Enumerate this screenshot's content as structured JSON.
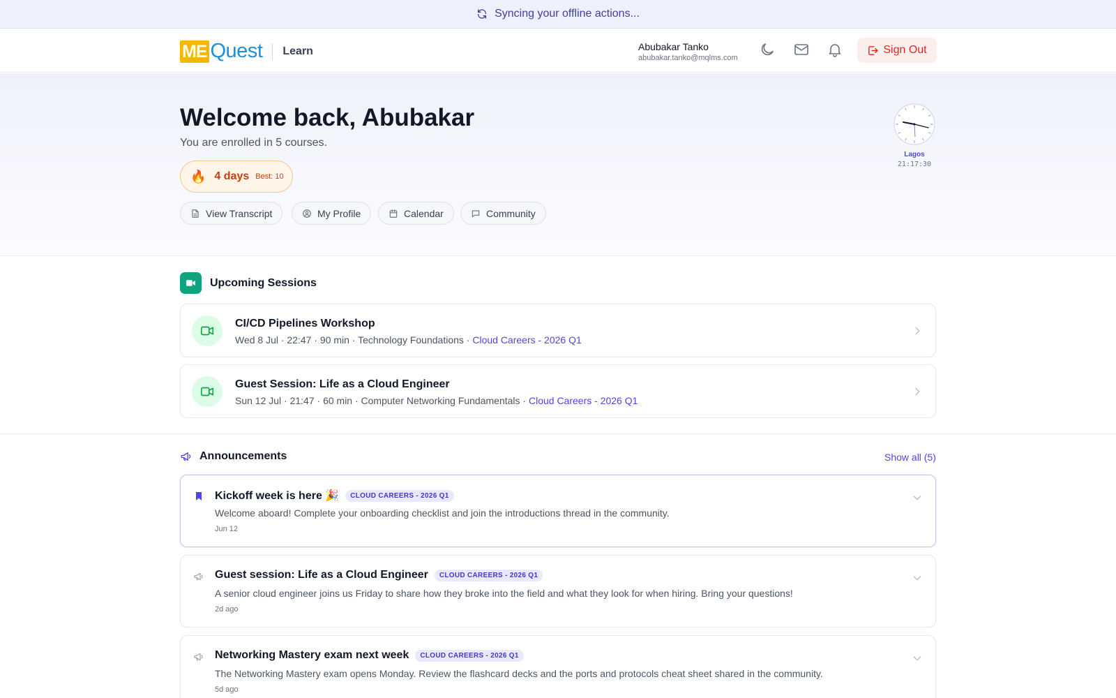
{
  "sync_banner": {
    "text": "Syncing your offline actions...",
    "icon": "refresh-icon"
  },
  "header": {
    "logo_me": "ME",
    "logo_quest": "Quest",
    "section": "Learn",
    "user_name": "Abubakar Tanko",
    "user_email": "abubakar.tanko@mqlms.com",
    "icons": [
      "moon-icon",
      "mail-icon",
      "bell-icon"
    ],
    "sign_out": "Sign Out"
  },
  "hero": {
    "greeting": "Welcome back, Abubakar",
    "enrolled": "You are enrolled in 5 courses.",
    "streak": {
      "icon": "🔥",
      "days": "4 days",
      "best": "Best: 10"
    },
    "actions": [
      "View Transcript",
      "My Profile",
      "Calendar",
      "Community"
    ],
    "clock": {
      "city": "Lagos",
      "time": "21:17:30"
    }
  },
  "sessions": {
    "title": "Upcoming Sessions",
    "items": [
      {
        "title": "CI/CD Pipelines Workshop",
        "meta": "Wed 8 Jul · 22:47 · 90 min  · Technology Foundations · ",
        "cohort": "Cloud Careers - 2026 Q1"
      },
      {
        "title": "Guest Session: Life as a Cloud Engineer",
        "meta": "Sun 12 Jul · 21:47 · 60 min  · Computer Networking Fundamentals · ",
        "cohort": "Cloud Careers - 2026 Q1"
      }
    ]
  },
  "announcements": {
    "title": "Announcements",
    "show_all": "Show all (5)",
    "items": [
      {
        "title": "Kickoff week is here 🎉",
        "tag": "CLOUD CAREERS - 2026 Q1",
        "body": "Welcome aboard! Complete your onboarding checklist and join the introductions thread in the community.",
        "date": "Jun 12"
      },
      {
        "title": "Guest session: Life as a Cloud Engineer",
        "tag": "CLOUD CAREERS - 2026 Q1",
        "body": "A senior cloud engineer joins us Friday to share how they broke into the field and what they look for when hiring. Bring your questions!",
        "date": "2d ago"
      },
      {
        "title": "Networking Mastery exam next week",
        "tag": "CLOUD CAREERS - 2026 Q1",
        "body": "The Networking Mastery exam opens Monday. Review the flashcard decks and the ports and protocols cheat sheet shared in the community.",
        "date": "5d ago"
      }
    ]
  },
  "colors": {
    "accent": "#4f46e5",
    "brand_yellow": "#f5b800",
    "brand_blue": "#1f8fd6",
    "sign_out": "#dc2626",
    "session_green": "#10a37f"
  }
}
